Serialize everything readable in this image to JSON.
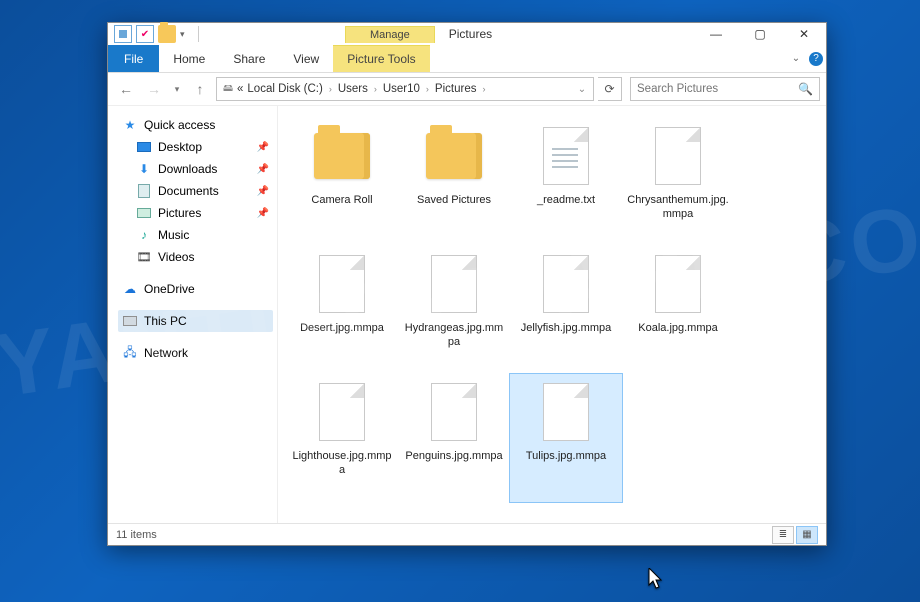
{
  "page": {
    "watermark": "MYANTISPYWARE.COM"
  },
  "window": {
    "title": "Pictures"
  },
  "ribbon": {
    "context_label": "Manage",
    "tabs": [
      "File",
      "Home",
      "Share",
      "View",
      "Picture Tools"
    ]
  },
  "address": {
    "crumbs": [
      "Local Disk (C:)",
      "Users",
      "User10",
      "Pictures"
    ]
  },
  "search": {
    "placeholder": "Search Pictures"
  },
  "sidebar": {
    "quick_access": {
      "label": "Quick access",
      "items": [
        "Desktop",
        "Downloads",
        "Documents",
        "Pictures",
        "Music",
        "Videos"
      ]
    },
    "onedrive": "OneDrive",
    "this_pc": "This PC",
    "network": "Network"
  },
  "items": [
    {
      "name": "Camera Roll",
      "type": "folder",
      "selected": false
    },
    {
      "name": "Saved Pictures",
      "type": "folder",
      "selected": false
    },
    {
      "name": "_readme.txt",
      "type": "txt",
      "selected": false
    },
    {
      "name": "Chrysanthemum.jpg.mmpa",
      "type": "file",
      "selected": false
    },
    {
      "name": "Desert.jpg.mmpa",
      "type": "file",
      "selected": false
    },
    {
      "name": "Hydrangeas.jpg.mmpa",
      "type": "file",
      "selected": false
    },
    {
      "name": "Jellyfish.jpg.mmpa",
      "type": "file",
      "selected": false
    },
    {
      "name": "Koala.jpg.mmpa",
      "type": "file",
      "selected": false
    },
    {
      "name": "Lighthouse.jpg.mmpa",
      "type": "file",
      "selected": false
    },
    {
      "name": "Penguins.jpg.mmpa",
      "type": "file",
      "selected": false
    },
    {
      "name": "Tulips.jpg.mmpa",
      "type": "file",
      "selected": true
    }
  ],
  "status": {
    "item_count": "11 items"
  }
}
